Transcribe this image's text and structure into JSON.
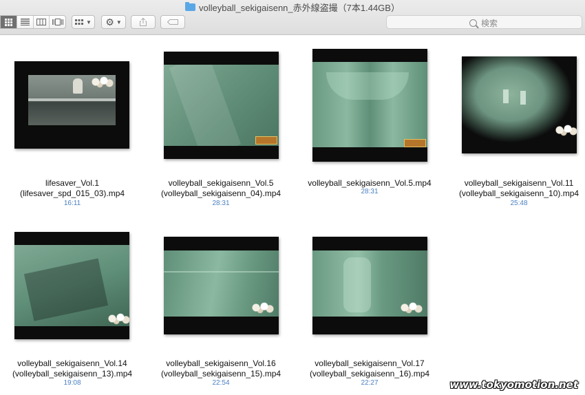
{
  "window": {
    "title": "volleyball_sekigaisenn_赤外線盗撮（7本1.44GB）"
  },
  "toolbar": {
    "view_modes": [
      "icon-view",
      "list-view",
      "column-view",
      "cover-flow-view"
    ],
    "search_placeholder": "検索"
  },
  "items": [
    {
      "line1": "lifesaver_Vol.1",
      "line2": "(lifesaver_spd_015_03).mp4",
      "duration": "16:11"
    },
    {
      "line1": "volleyball_sekigaisenn_Vol.5",
      "line2": "(volleyball_sekigaisenn_04).mp4",
      "duration": "28:31"
    },
    {
      "line1": "volleyball_sekigaisenn_Vol.5.mp4",
      "line2": "",
      "duration": "28:31"
    },
    {
      "line1": "volleyball_sekigaisenn_Vol.11",
      "line2": "(volleyball_sekigaisenn_10).mp4",
      "duration": "25:48"
    },
    {
      "line1": "volleyball_sekigaisenn_Vol.14",
      "line2": "(volleyball_sekigaisenn_13).mp4",
      "duration": "19:08"
    },
    {
      "line1": "volleyball_sekigaisenn_Vol.16",
      "line2": "(volleyball_sekigaisenn_15).mp4",
      "duration": "22:54"
    },
    {
      "line1": "volleyball_sekigaisenn_Vol.17",
      "line2": "(volleyball_sekigaisenn_16).mp4",
      "duration": "22:27"
    }
  ],
  "watermark": "www.tokyomotion.net",
  "colors": {
    "duration_text": "#4a7fc1",
    "thumbnail_green": "#5f8f78",
    "folder_icon": "#5aa7e6"
  }
}
